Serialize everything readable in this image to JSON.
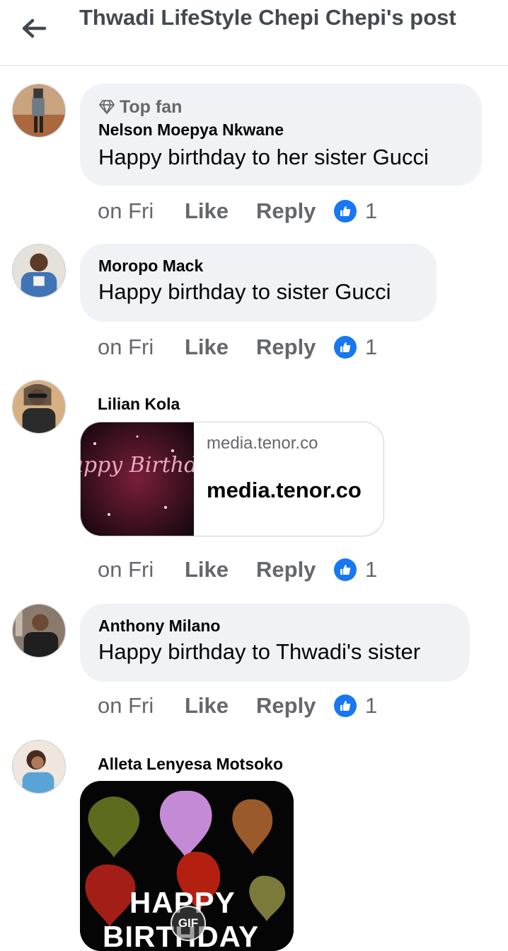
{
  "header": {
    "title": "Thwadi LifeStyle Chepi Chepi's post"
  },
  "comments": [
    {
      "author": "Nelson Moepya Nkwane",
      "badge": "Top fan",
      "text": "Happy birthday to her sister  Gucci",
      "time": "on Fri",
      "like": "Like",
      "reply": "Reply",
      "reactions": "1"
    },
    {
      "author": "Moropo Mack",
      "text": "Happy birthday to sister Gucci",
      "time": "on Fri",
      "like": "Like",
      "reply": "Reply",
      "reactions": "1"
    },
    {
      "author": "Lilian Kola",
      "link": {
        "domain": "media.tenor.co",
        "title": "media.tenor.co",
        "thumb_caption": "Happy Birthday"
      },
      "time": "on Fri",
      "like": "Like",
      "reply": "Reply",
      "reactions": "1"
    },
    {
      "author": "Anthony Milano",
      "text": "Happy birthday to Thwadi's sister",
      "time": "on Fri",
      "like": "Like",
      "reply": "Reply",
      "reactions": "1"
    },
    {
      "author": "Alleta Lenyesa Motsoko",
      "gif": {
        "line1": "HAPPY",
        "line2": "BIRTHDAY",
        "label": "GIF"
      }
    }
  ],
  "colors": {
    "like_badge": "#1877f2",
    "bubble": "#f0f2f5",
    "muted": "#65676b"
  }
}
